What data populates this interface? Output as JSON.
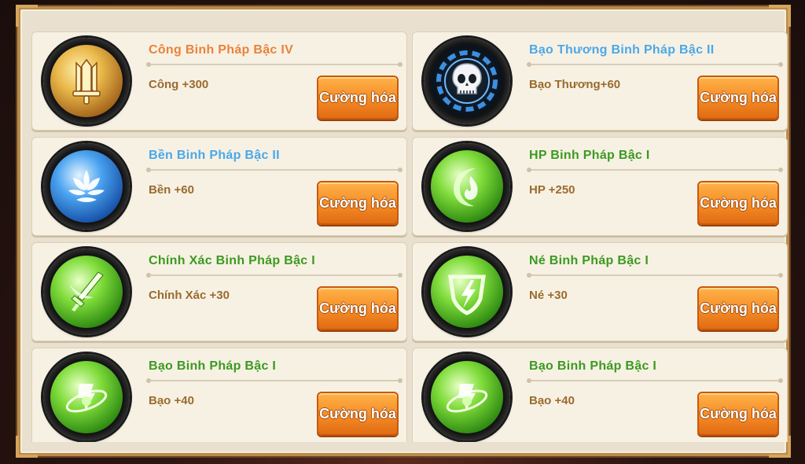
{
  "upgrade_button_label": "Cường hóa",
  "colors": {
    "orange": "#e8833a",
    "blue": "#4aa8e8",
    "green": "#3b9a1f",
    "button": "#f58b25"
  },
  "cards": [
    {
      "title": "Công Binh Pháp Bậc IV",
      "stat": "Công +300",
      "title_color": "orange",
      "icon": "trident-icon"
    },
    {
      "title": "Bạo Thương Binh Pháp Bậc II",
      "stat": "Bạo Thương+60",
      "title_color": "blue",
      "icon": "skull-icon"
    },
    {
      "title": "Bền Binh Pháp Bậc II",
      "stat": "Bền +60",
      "title_color": "blue",
      "icon": "lotus-icon"
    },
    {
      "title": "HP Binh Pháp Bậc I",
      "stat": "HP +250",
      "title_color": "green",
      "icon": "flame-crescent-icon"
    },
    {
      "title": "Chính Xác Binh Pháp Bậc I",
      "stat": "Chính Xác +30",
      "title_color": "green",
      "icon": "sword-icon"
    },
    {
      "title": "Né Binh Pháp Bậc I",
      "stat": "Né +30",
      "title_color": "green",
      "icon": "lightning-shield-icon"
    },
    {
      "title": "Bạo Binh Pháp Bậc I",
      "stat": "Bạo +40",
      "title_color": "green",
      "icon": "orbit-icon"
    },
    {
      "title": "Bạo Binh Pháp Bậc I",
      "stat": "Bạo +40",
      "title_color": "green",
      "icon": "orbit-icon"
    }
  ]
}
